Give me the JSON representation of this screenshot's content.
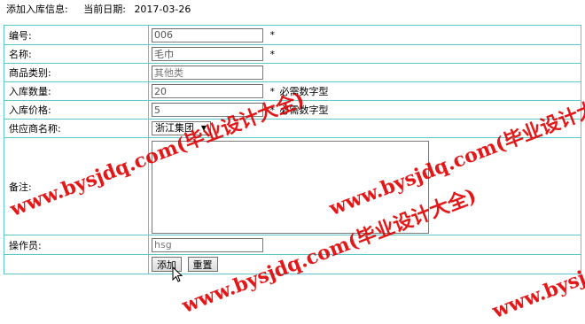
{
  "header": {
    "title": "添加入库信息:",
    "date_label": "当前日期:",
    "date_value": "2017-03-26"
  },
  "form": {
    "code": {
      "label": "编号:",
      "value": "006",
      "required": "*"
    },
    "name": {
      "label": "名称:",
      "value": "毛巾",
      "required": "*"
    },
    "category": {
      "label": "商品类别:",
      "value": "其他类"
    },
    "quantity": {
      "label": "入库数量:",
      "value": "20",
      "required": "*",
      "hint": "必需数字型"
    },
    "price": {
      "label": "入库价格:",
      "value": "5",
      "required": "*",
      "hint": "必需数字型"
    },
    "supplier": {
      "label": "供应商名称:",
      "selected": "浙江集团",
      "arrow": "▼"
    },
    "remark": {
      "label": "备注:",
      "value": ""
    },
    "operator": {
      "label": "操作员:",
      "value": "hsg"
    }
  },
  "buttons": {
    "add": "添加",
    "reset": "重置"
  },
  "watermark": {
    "text": "www.bysjdq.com(毕业设计大全)",
    "color": "#e00000"
  }
}
